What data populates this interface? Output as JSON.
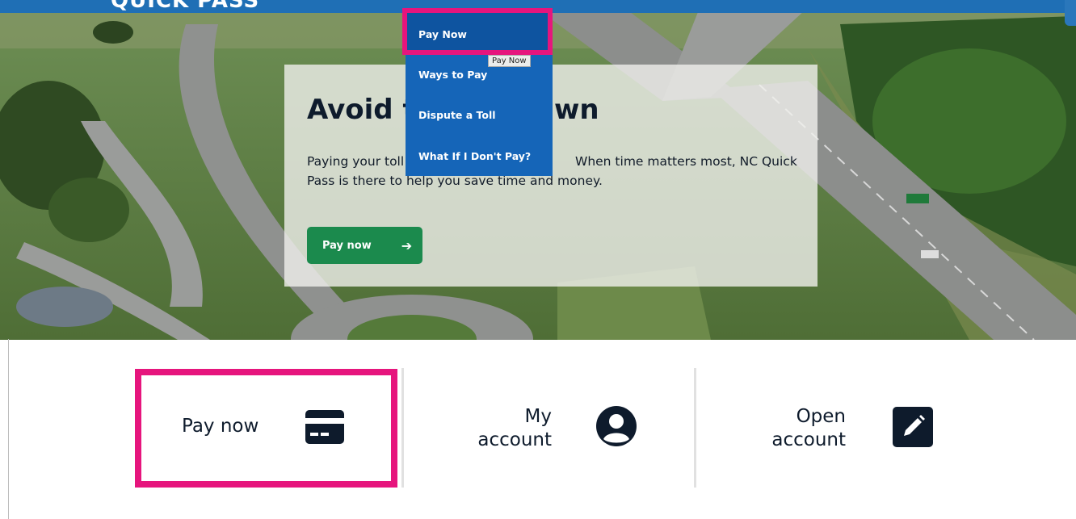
{
  "header": {
    "logo_text": "QUICK PASS"
  },
  "hero": {
    "heading_part1": "Avoid t",
    "heading_part2": "wn",
    "text_line1_a": "Paying your toll",
    "text_line1_b": "When time matters most, NC Quick",
    "text_line2": "Pass is there to help you save time and money.",
    "button_label": "Pay now",
    "button_icon": "arrow-right-icon"
  },
  "dropdown": {
    "items": [
      "Pay Now",
      "Ways to Pay",
      "Dispute a Toll",
      "What If I Don't Pay?"
    ],
    "active_index": 0,
    "tooltip": "Pay Now"
  },
  "tiles": [
    {
      "label": "Pay now",
      "icon": "credit-card-icon"
    },
    {
      "label_line1": "My",
      "label_line2": "account",
      "icon": "user-circle-icon"
    },
    {
      "label_line1": "Open",
      "label_line2": "account",
      "icon": "edit-icon"
    }
  ],
  "colors": {
    "highlight": "#e6157d",
    "menu_bg": "#1565b8",
    "button_green": "#1b8a4d",
    "header_blue": "#1f6fb5"
  }
}
